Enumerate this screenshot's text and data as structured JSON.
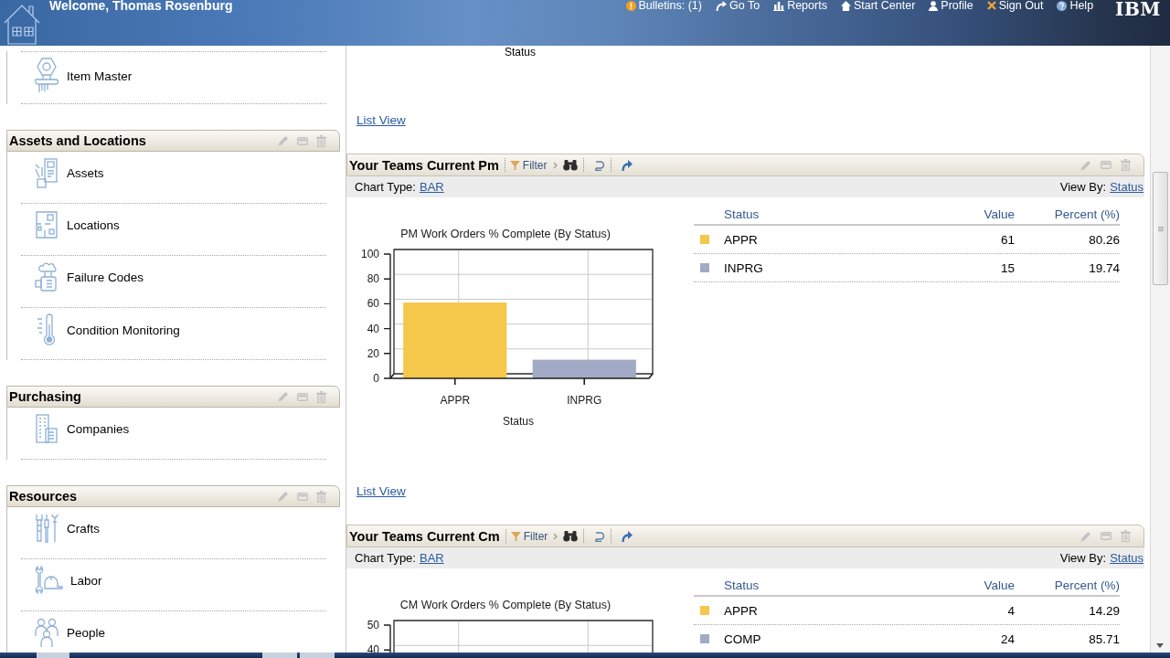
{
  "header": {
    "welcome": "Welcome, Thomas Rosenburg",
    "links": [
      {
        "label": "Bulletins: (1)",
        "kind": "bulletin"
      },
      {
        "label": "Go To",
        "kind": "goto"
      },
      {
        "label": "Reports",
        "kind": "report"
      },
      {
        "label": "Start Center",
        "kind": "home"
      },
      {
        "label": "Profile",
        "kind": "profile"
      },
      {
        "label": "Sign Out",
        "kind": "signout"
      },
      {
        "label": "Help",
        "kind": "help"
      }
    ],
    "logo": "IBM"
  },
  "sidebar": {
    "portlets": [
      {
        "items": [
          {
            "label": "Item Master",
            "kind": "part"
          }
        ]
      },
      {
        "title": "Assets and Locations",
        "items": [
          {
            "label": "Assets",
            "kind": "asset"
          },
          {
            "label": "Locations",
            "kind": "location"
          },
          {
            "label": "Failure Codes",
            "kind": "failure"
          },
          {
            "label": "Condition Monitoring",
            "kind": "monitor"
          }
        ]
      },
      {
        "title": "Purchasing",
        "items": [
          {
            "label": "Companies",
            "kind": "company"
          }
        ]
      },
      {
        "title": "Resources",
        "items": [
          {
            "label": "Crafts",
            "kind": "craft"
          },
          {
            "label": "Labor",
            "kind": "labor"
          },
          {
            "label": "People",
            "kind": "people"
          }
        ]
      }
    ]
  },
  "main": {
    "previous_portlet": {
      "chart_xlabel": "Status",
      "link": "List View"
    },
    "portlets": [
      {
        "title": "Your Teams Current Pm",
        "filter": "Filter",
        "chart_type_label": "Chart Type:",
        "chart_type": "BAR",
        "view_by_label": "View By:",
        "view_by": "Status",
        "chart_data": {
          "type": "bar",
          "title": "PM Work Orders % Complete (By Status)",
          "xlabel": "Status",
          "categories": [
            "APPR",
            "INPRG"
          ],
          "values": [
            61,
            15
          ],
          "ylim": [
            0,
            100
          ],
          "yticks": [
            0,
            20,
            40,
            60,
            80,
            100
          ]
        },
        "table": {
          "columns": [
            "Status",
            "Value",
            "Percent (%)"
          ],
          "rows": [
            {
              "status": "APPR",
              "value": "61",
              "percent": "80.26",
              "color": "#f5c84c"
            },
            {
              "status": "INPRG",
              "value": "15",
              "percent": "19.74",
              "color": "#a3aac6"
            }
          ]
        },
        "link": "List View"
      },
      {
        "title": "Your Teams Current Cm",
        "filter": "Filter",
        "chart_type_label": "Chart Type:",
        "chart_type": "BAR",
        "view_by_label": "View By:",
        "view_by": "Status",
        "chart_data": {
          "type": "bar",
          "title": "CM Work Orders % Complete (By Status)",
          "categories": [
            null,
            null
          ],
          "ylim": [
            37.9,
            50
          ],
          "yticks": [
            40,
            50
          ]
        },
        "table": {
          "columns": [
            "Status",
            "Value",
            "Percent (%)"
          ],
          "rows": [
            {
              "status": "APPR",
              "value": "4",
              "percent": "14.29",
              "color": "#f5c84c"
            },
            {
              "status": "COMP",
              "value": "24",
              "percent": "85.71",
              "color": "#a3aac6"
            }
          ]
        }
      }
    ]
  }
}
